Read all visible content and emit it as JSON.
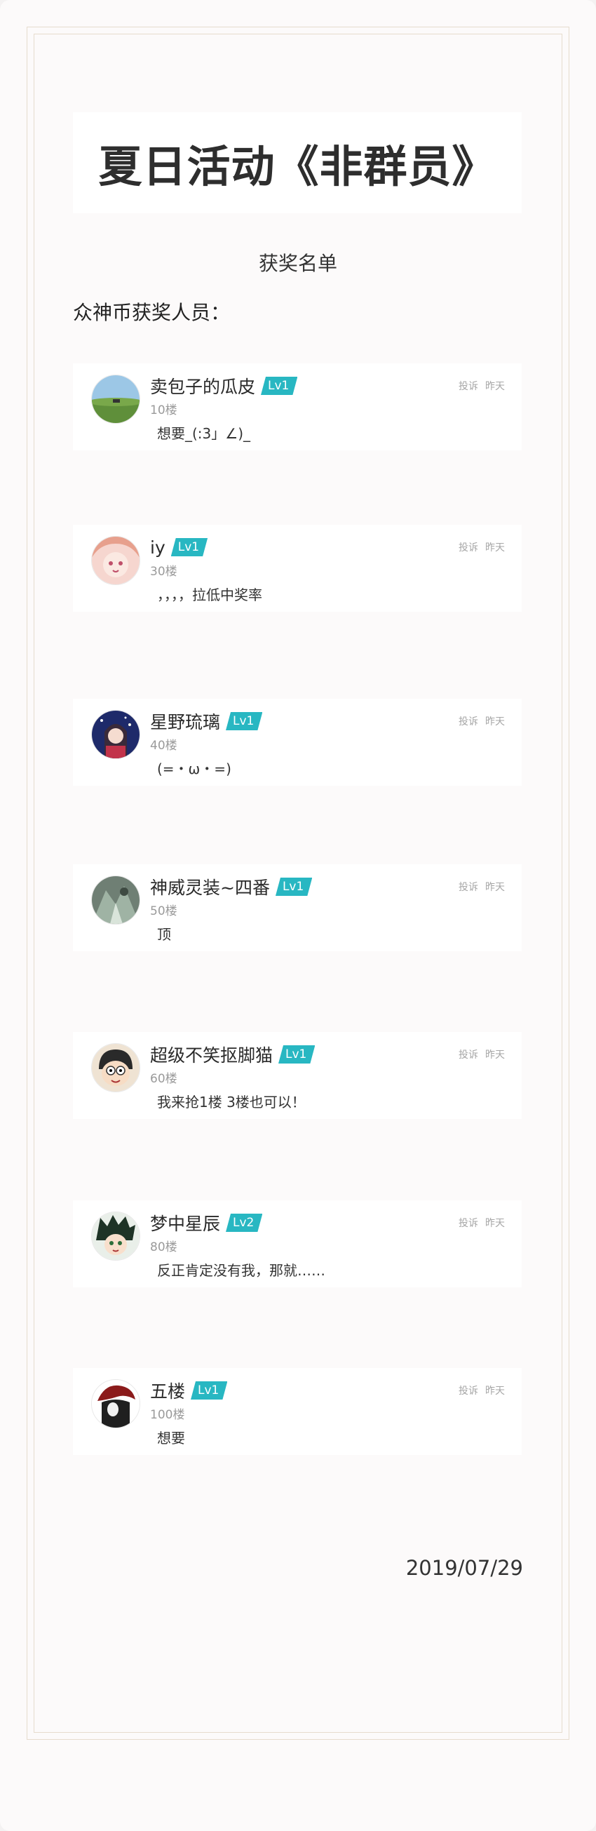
{
  "title": "夏日活动《非群员》",
  "subtitle": "获奖名单",
  "section_label": "众神币获奖人员：",
  "posts": [
    {
      "name": "卖包子的瓜皮",
      "level": "Lv1",
      "floor": "10楼",
      "comment": "想要_(:3」∠)_",
      "report": "投诉",
      "time": "昨天",
      "avatar_icon": "landscape-avatar"
    },
    {
      "name": "iy",
      "level": "Lv1",
      "floor": "30楼",
      "comment": "，，，，拉低中奖率",
      "report": "投诉",
      "time": "昨天",
      "avatar_icon": "anime-girl-pink-avatar"
    },
    {
      "name": "星野琉璃",
      "level": "Lv1",
      "floor": "40楼",
      "comment": "(=・ω・=)",
      "report": "投诉",
      "time": "昨天",
      "avatar_icon": "anime-girl-night-avatar"
    },
    {
      "name": "神威灵装~四番",
      "level": "Lv1",
      "floor": "50楼",
      "comment": "顶",
      "report": "投诉",
      "time": "昨天",
      "avatar_icon": "green-art-avatar"
    },
    {
      "name": "超级不笑抠脚猫",
      "level": "Lv1",
      "floor": "60楼",
      "comment": "我来抢1楼 3楼也可以！",
      "report": "投诉",
      "time": "昨天",
      "avatar_icon": "cartoon-boy-avatar"
    },
    {
      "name": "梦中星辰",
      "level": "Lv2",
      "floor": "80楼",
      "comment": "反正肯定没有我，那就……",
      "report": "投诉",
      "time": "昨天",
      "avatar_icon": "anime-boy-avatar"
    },
    {
      "name": "五楼",
      "level": "Lv1",
      "floor": "100楼",
      "comment": "想要",
      "report": "投诉",
      "time": "昨天",
      "avatar_icon": "red-hair-character-avatar"
    }
  ],
  "date": "2019/07/29",
  "colors": {
    "badge": "#28b7c2",
    "frame": "#e6dccd",
    "page_bg": "#fcfafa"
  }
}
